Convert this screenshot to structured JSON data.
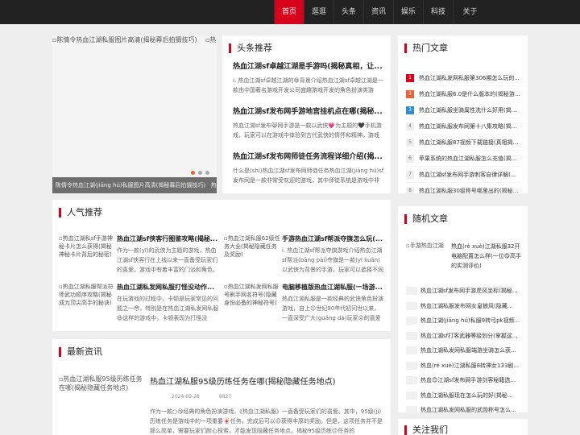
{
  "nav": {
    "items": [
      {
        "label": "首页",
        "active": true
      },
      {
        "label": "逛逛"
      },
      {
        "label": "头条"
      },
      {
        "label": "资讯"
      },
      {
        "label": "娱乐"
      },
      {
        "label": "科技"
      },
      {
        "label": "关于"
      }
    ]
  },
  "slider": {
    "image_alt": "陈情令热血江湖私服图片高清(揭秘幕后拍摄技巧)",
    "image_alt_next": "热",
    "caption": "陈情令热血江湖(jiāng hú)私服图片高清(揭秘幕后拍摄技巧)",
    "caption_next": "热血",
    "dots": 3
  },
  "headlines": {
    "title": "头条推荐",
    "items": [
      {
        "title": "热血江湖sf卓越江湖是手游吗(揭秘真相，让...",
        "desc": "i. 热血江湖sf卓越江湖的😄背景介绍热血江湖sf卓越江湖是一款由中国著名游戏开发公司盛趣游戏开发的角色扮演类游"
      },
      {
        "title": "热血江湖sf发布网手游地宫挂机点在哪(揭秘...",
        "desc": "热血江湖sf发布😸网手游是一款以武侠💗为主题的🖤手机游戏，玩家可以在游戏中体验到古代武侠的情怀和精神。游戏"
      },
      {
        "title": "热血江湖sf发布网师徒任务流程详细介绍(揭...",
        "desc": "什么是(shì)热血江湖sf发布网师徒任务热血江湖(jiāng hú)sf发布网是一款非常受欢迎的游戏，其中师徒系统是游戏中非"
      }
    ]
  },
  "hot": {
    "title": "热门文章",
    "items": [
      {
        "rank": "1",
        "text": "热血江湖私发网私服第306期怎么玩的..."
      },
      {
        "rank": "2",
        "text": "热血江湖私服6.0是什么版本的(揭秘游..."
      },
      {
        "rank": "3",
        "text": "热血江湖私服坐骑属性洗什么好用(揭..."
      },
      {
        "rank": "4",
        "text": "热血江湖私服发布网第十八集攻略(揭..."
      },
      {
        "rank": "5",
        "text": "热血江湖私服87视频下载链接(真相揭..."
      },
      {
        "rank": "6",
        "text": "苹果系统的热血江湖私服怎么充值(揭..."
      },
      {
        "rank": "7",
        "text": "热血江湖sf发布网手游刺客自律详解(..."
      },
      {
        "rank": "8",
        "text": "热血江湖私服30级称号哪里出的(揭秘..."
      }
    ]
  },
  "popular": {
    "title": "人气推荐",
    "items": [
      {
        "img_alt": "热血江湖私sf手游神秘卡片怎么获得(揭秘神秘卡片背后的秘密)",
        "title": "热血江湖sf侠客行图鉴攻略(揭秘...",
        "desc": "作为一款(yī)的武侠为主题的游戏，热血江湖sf侠客行在上线以来一直备受玩家们的喜爱。游戏中有着丰富的门派和角色，"
      },
      {
        "img_alt": "热血江湖私服62级任务大全(揭秘隐藏任务及奖励)",
        "title": "手游热血江湖sf帮派夺旗怎么玩(...",
        "desc": "i. 热血江湖sf帮派夺旗游戏介绍热血江湖sf帮派(bāng pài)夺旗是一款(yī kuǎn)以武侠为背景的手游，玩家可以选择不同的"
      },
      {
        "img_alt": "热血江湖私服帮派符师武功顺序攻略(揭秘成为顶尖高手的秘诀)",
        "title": "热血江湖私发网私服打怪没动作...",
        "desc": "在玩游戏的过程中，卡顿是玩家常见的问题之一😳，特别是在热血江湖私发网私服😆这样的游戏中，卡顿表现为打怪没"
      },
      {
        "img_alt": "热血江湖私发网私服号刷手网名符号(隐藏身份必备的神秘符号)",
        "title": "电脑移植版热血江湖私服(一场游...",
        "desc": "热血江湖私服是一款经典的武侠角色扮演游戏，自上😉世纪90年代初问世以来，一直深受广大(guǎng dà)玩家😮的喜爱和追"
      }
    ]
  },
  "random": {
    "title": "随机文章",
    "top": {
      "img_alt": "手游热血江湖",
      "text": "热血(rè xuè)江湖私服32开电脑配置怎么样(一位😋高手的实测评价)"
    },
    "items": [
      "热血江湖sf发布网手游虎风坐标(揭秘...",
      "热血江湖私服发布网女皇披风(隐藏...",
      "热血江湖(jiāng hú)私服9转弓pk视频...",
      "热血江湖sf打客武器等级划分(掌握这...",
      "热血江湖私发网私服端游坐骑怎么获...",
      "热血(rè xuè)江湖私服8转神女133剧...",
      "热血😊江湖sf发布网手游剑客秘籍选...",
      "热血江湖私服现在怎么玩的好(揭秘...",
      "热血江湖私发网私服的武勋称号怎么..."
    ]
  },
  "latest": {
    "title": "最新资讯",
    "img_alt": "热血江湖私服95级历练任务在哪(揭秘隐藏任务地点)",
    "headline": "热血江湖私服95级历练任务在哪(揭秘隐藏任务地点)",
    "date": "2024-09-28",
    "views": "8827",
    "desc": "作为一款○😘经典的角色扮演游戏，《热血江湖私服》一直备受玩家们的喜爱。其中，95级(jí)历练任务是游戏中的一项重要🀄任务，完成后可以😉获得丰厚的奖励。但是，这项任务并不是那么简单，需要玩家们耐心探索，才能发现隐藏任务地点。揭秘95级历练😉任务的"
  },
  "about": {
    "title": "关注我们"
  }
}
